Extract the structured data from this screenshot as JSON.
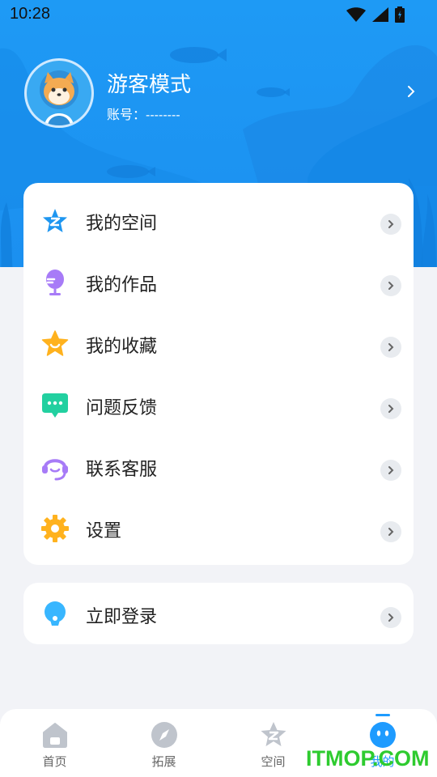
{
  "status_bar": {
    "time": "10:28"
  },
  "profile": {
    "name": "游客模式",
    "account": "账号：--------"
  },
  "menu": [
    {
      "label": "我的空间",
      "icon": "qzone-star-icon",
      "color": "#1e96f0"
    },
    {
      "label": "我的作品",
      "icon": "microphone-icon",
      "color": "#a77bf7"
    },
    {
      "label": "我的收藏",
      "icon": "star-icon",
      "color": "#ffb21e"
    },
    {
      "label": "问题反馈",
      "icon": "chat-bubble-icon",
      "color": "#22d0a0"
    },
    {
      "label": "联系客服",
      "icon": "headset-icon",
      "color": "#a77bf7"
    },
    {
      "label": "设置",
      "icon": "gear-icon",
      "color": "#ffb21e"
    }
  ],
  "login": {
    "label": "立即登录",
    "icon": "login-person-icon",
    "color": "#38b6ff"
  },
  "bottom_nav": [
    {
      "label": "首页",
      "icon": "home-icon"
    },
    {
      "label": "拓展",
      "icon": "compass-icon"
    },
    {
      "label": "空间",
      "icon": "qzone-star-icon"
    },
    {
      "label": "我的",
      "icon": "smiley-face-icon",
      "active": true
    }
  ],
  "watermark": "ITMOP.COM",
  "colors": {
    "header_blue": "#1b96f3",
    "accent": "#1e9bff"
  }
}
